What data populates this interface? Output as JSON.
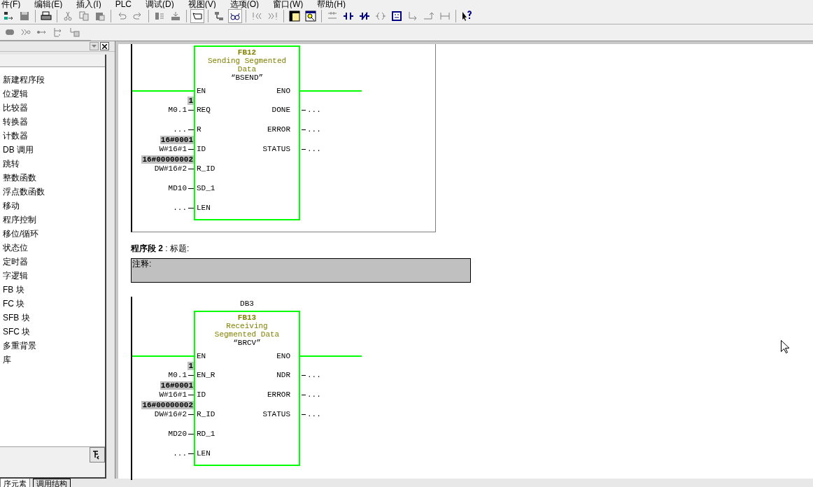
{
  "menu": [
    "件(F)",
    "编辑(E)",
    "插入(I)",
    "PLC",
    "调试(D)",
    "视图(V)",
    "选项(O)",
    "窗口(W)",
    "帮助(H)"
  ],
  "sidebar": {
    "items": [
      "新建程序段",
      "位逻辑",
      "比较器",
      "转换器",
      "计数器",
      "DB 调用",
      "跳转",
      "整数函数",
      "浮点数函数",
      "移动",
      "程序控制",
      "移位/循环",
      "状态位",
      "定时器",
      "字逻辑",
      "FB 块",
      "FC 块",
      "SFB 块",
      "SFC 块",
      "多重背景",
      "库"
    ]
  },
  "tabs": [
    {
      "label": "序元素",
      "selected": true
    },
    {
      "label": "调用结构",
      "selected": false
    }
  ],
  "networks": [
    {
      "selected": true,
      "block": {
        "name": "FB12",
        "description": [
          "Sending Segmented",
          "Data"
        ],
        "symbol": "“BSEND”",
        "inputs": [
          {
            "param": "EN",
            "wire": true
          },
          {
            "param": "REQ",
            "operand": "M0.1",
            "value": "1"
          },
          {
            "param": "R",
            "operand": "..."
          },
          {
            "param": "ID",
            "operand": "W#16#1",
            "value": "16#0001"
          },
          {
            "param": "R_ID",
            "operand": "DW#16#2",
            "value": "16#00000002"
          },
          {
            "param": "SD_1",
            "operand": "MD10"
          },
          {
            "param": "LEN",
            "operand": "..."
          }
        ],
        "outputs": [
          {
            "param": "ENO",
            "wire": true
          },
          {
            "param": "DONE",
            "operand": "..."
          },
          {
            "param": "ERROR",
            "operand": "..."
          },
          {
            "param": "STATUS",
            "operand": "..."
          }
        ]
      }
    },
    {
      "selected": false,
      "title": "**程序段 2** : 标题:",
      "comment": "注释:",
      "block": {
        "instance": "DB3",
        "name": "FB13",
        "description": [
          "Receiving",
          "Segmented Data"
        ],
        "symbol": "“BRCV”",
        "inputs": [
          {
            "param": "EN",
            "wire": true
          },
          {
            "param": "EN_R",
            "operand": "M0.1",
            "value": "1"
          },
          {
            "param": "ID",
            "operand": "W#16#1",
            "value": "16#0001"
          },
          {
            "param": "R_ID",
            "operand": "DW#16#2",
            "value": "16#00000002"
          },
          {
            "param": "RD_1",
            "operand": "MD20"
          },
          {
            "param": "LEN",
            "operand": "..."
          }
        ],
        "outputs": [
          {
            "param": "ENO",
            "wire": true
          },
          {
            "param": "NDR",
            "operand": "..."
          },
          {
            "param": "ERROR",
            "operand": "..."
          },
          {
            "param": "STATUS",
            "operand": "..."
          }
        ]
      }
    }
  ]
}
